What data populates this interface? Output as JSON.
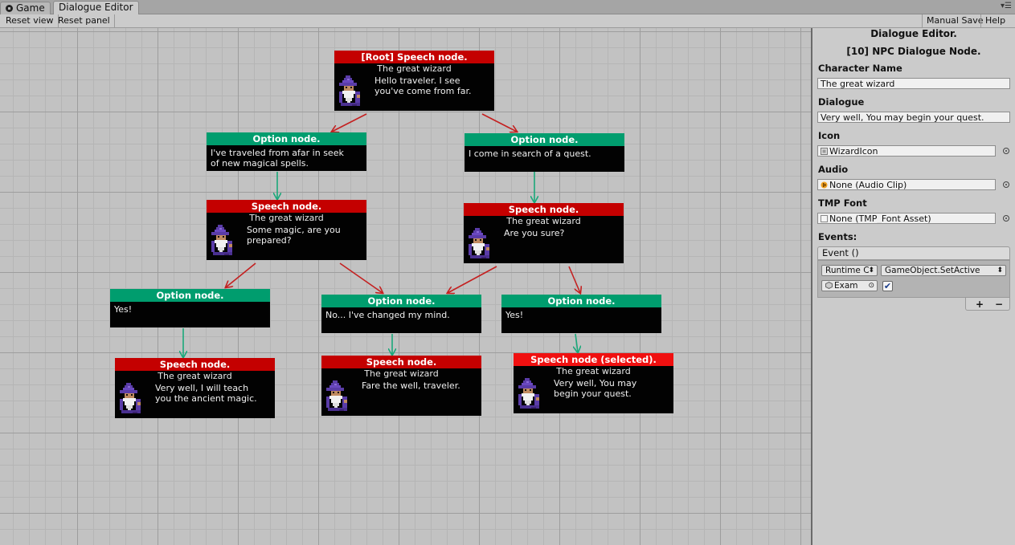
{
  "tabs": [
    {
      "label": "Game",
      "active": false
    },
    {
      "label": "Dialogue Editor",
      "active": true
    }
  ],
  "tab_menu_icon": "tab-menu-icon",
  "toolbar": {
    "reset_view": "Reset view",
    "reset_panel": "Reset panel",
    "manual_save": "Manual Save",
    "help": "Help"
  },
  "nodes": {
    "root": {
      "header": "[Root] Speech node.",
      "character": "The great wizard",
      "dialogue": "Hello traveler. I see\nyou've come from far."
    },
    "opt_seek": {
      "header": "Option node.",
      "text": "I've traveled from afar in seek\nof new magical spells."
    },
    "opt_quest": {
      "header": "Option node.",
      "text": "I come in search of a quest."
    },
    "sp_prepared": {
      "header": "Speech node.",
      "character": "The great wizard",
      "dialogue": "Some magic, are you\nprepared?"
    },
    "sp_sure": {
      "header": "Speech node.",
      "character": "The great wizard",
      "dialogue": "Are you sure?"
    },
    "opt_yes1": {
      "header": "Option node.",
      "text": "Yes!"
    },
    "opt_no": {
      "header": "Option node.",
      "text": "No... I've changed my mind."
    },
    "opt_yes2": {
      "header": "Option node.",
      "text": "Yes!"
    },
    "sp_teach": {
      "header": "Speech node.",
      "character": "The great wizard",
      "dialogue": "Very well, I will teach\nyou the ancient magic."
    },
    "sp_farewell": {
      "header": "Speech node.",
      "character": "The great wizard",
      "dialogue": "Fare the well, traveler."
    },
    "sp_selected": {
      "header": "Speech node (selected).",
      "character": "The great wizard",
      "dialogue": "Very well, You may\nbegin your quest."
    }
  },
  "colors": {
    "speech_header": "#c40000",
    "selected_header": "#f01010",
    "option_header": "#009d6e",
    "speech_link": "#c42020",
    "option_link": "#1aa87a"
  },
  "inspector": {
    "title": "Dialogue Editor.",
    "subtitle": "[10] NPC Dialogue Node.",
    "character_name_label": "Character Name",
    "character_name_value": "The great wizard",
    "dialogue_label": "Dialogue",
    "dialogue_value": "Very well, You may begin your quest.",
    "icon_label": "Icon",
    "icon_value": "WizardIcon",
    "audio_label": "Audio",
    "audio_value": "None (Audio Clip)",
    "font_label": "TMP Font",
    "font_value": "None (TMP_Font Asset)",
    "events_label": "Events:",
    "event_header": "Event ()",
    "runtime_option": "Runtime C",
    "function_option": "GameObject.SetActive",
    "target_object": "Exam",
    "checkbox_checked": true,
    "add_symbol": "+",
    "remove_symbol": "−"
  }
}
